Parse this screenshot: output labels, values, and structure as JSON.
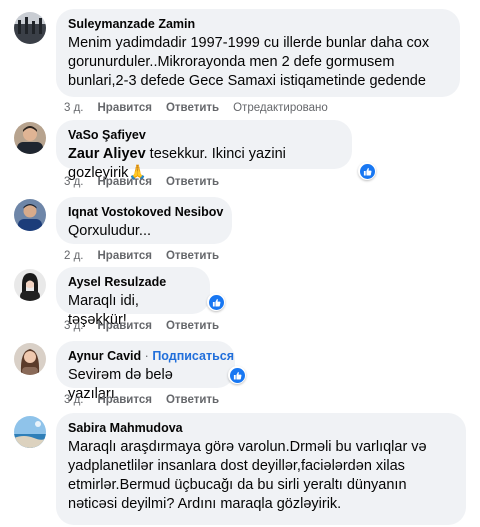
{
  "comments": [
    {
      "author": "Suleymanzade Zamin",
      "text": "Menim yadimdadir 1997-1999 cu illerde bunlar daha cox gorunurduler..Mikrorayonda men 2 defe gormusem bunlari,2-3 defede Gece Samaxi istiqametinde gedende",
      "time": "3 д.",
      "like": "Нравится",
      "reply": "Ответить",
      "edited": "Отредактировано"
    },
    {
      "author": "VaSo Şafiyev",
      "mention": "Zaur Aliyev",
      "text": " tesekkur. Ikinci yazini gozleyirik",
      "emoji": "🙏",
      "time": "3 д.",
      "like": "Нравится",
      "reply": "Ответить"
    },
    {
      "author": "Iqnat Vostokoved Nesibov",
      "text": "Qorxuludur...",
      "time": "2 д.",
      "like": "Нравится",
      "reply": "Ответить"
    },
    {
      "author": "Aysel Resulzade",
      "text": "Maraqlı idi, təşəkkür!",
      "time": "3 д.",
      "like": "Нравится",
      "reply": "Ответить"
    },
    {
      "author": "Aynur Cavid",
      "separator": "·",
      "subscribe": "Подписаться",
      "text": "Sevirəm də belə yazıları.",
      "time": "3 д.",
      "like": "Нравится",
      "reply": "Ответить"
    },
    {
      "author": "Sabira Mahmudova",
      "text": "Maraqlı araşdırmaya görə varolun.Drməli bu varlıqlar və yadplanetlilər insanlara dost deyillər,faciələrdən xilas etmirlər.Bermud üçbucağı da bu sirli yeraltı dünyanın nəticəsi deyilmi? Ardını maraqla gözləyirik."
    }
  ],
  "icons": {
    "like_reaction": "thumbs-up-reaction-icon"
  },
  "colors": {
    "bubble": "#f0f2f5",
    "meta": "#65676b",
    "subscribe": "#216fdb",
    "like": "#1877f2"
  }
}
